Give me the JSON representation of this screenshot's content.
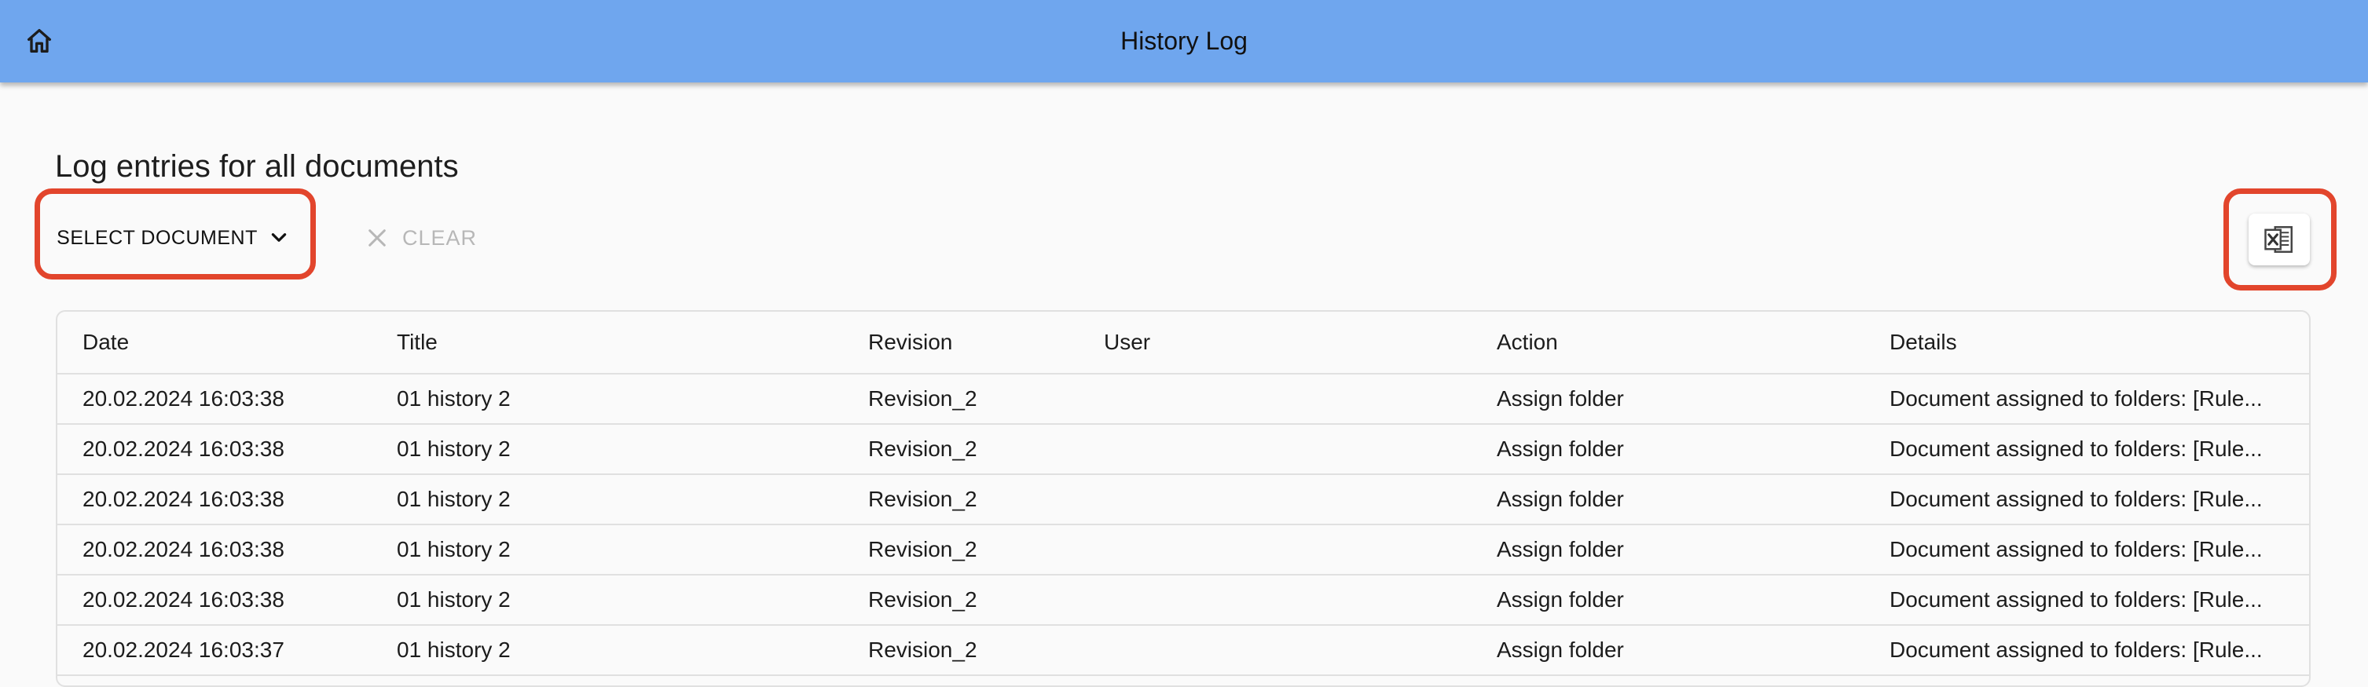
{
  "header": {
    "title": "History Log",
    "home_icon": "home-icon"
  },
  "page": {
    "heading": "Log entries for all documents"
  },
  "toolbar": {
    "select_document_label": "SELECT DOCUMENT",
    "select_icon": "chevron-down-icon",
    "clear_label": "CLEAR",
    "clear_icon": "close-icon",
    "export_icon": "excel-export-icon"
  },
  "colors": {
    "appbar": "#6fa6ee",
    "highlight": "#e2452c",
    "clear_disabled": "#b7b7b7"
  },
  "table": {
    "columns": [
      "Date",
      "Title",
      "Revision",
      "User",
      "Action",
      "Details"
    ],
    "rows": [
      {
        "date": "20.02.2024 16:03:38",
        "title": "01 history 2",
        "revision": "Revision_2",
        "user": "",
        "action": "Assign folder",
        "details": "Document assigned to folders: [Rule..."
      },
      {
        "date": "20.02.2024 16:03:38",
        "title": "01 history 2",
        "revision": "Revision_2",
        "user": "",
        "action": "Assign folder",
        "details": "Document assigned to folders: [Rule..."
      },
      {
        "date": "20.02.2024 16:03:38",
        "title": "01 history 2",
        "revision": "Revision_2",
        "user": "",
        "action": "Assign folder",
        "details": "Document assigned to folders: [Rule..."
      },
      {
        "date": "20.02.2024 16:03:38",
        "title": "01 history 2",
        "revision": "Revision_2",
        "user": "",
        "action": "Assign folder",
        "details": "Document assigned to folders: [Rule..."
      },
      {
        "date": "20.02.2024 16:03:38",
        "title": "01 history 2",
        "revision": "Revision_2",
        "user": "",
        "action": "Assign folder",
        "details": "Document assigned to folders: [Rule..."
      },
      {
        "date": "20.02.2024 16:03:37",
        "title": "01 history 2",
        "revision": "Revision_2",
        "user": "",
        "action": "Assign folder",
        "details": "Document assigned to folders: [Rule..."
      }
    ]
  }
}
